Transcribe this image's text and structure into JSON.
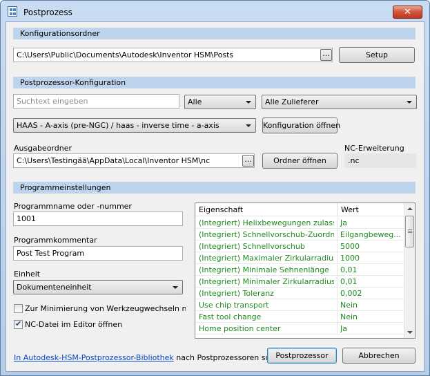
{
  "window": {
    "title": "Postprozess",
    "close_symbol": "✕",
    "icon": "app-icon"
  },
  "config_folder": {
    "section_title": "Konfigurationsordner",
    "path": "C:\\Users\\Public\\Documents\\Autodesk\\Inventor HSM\\Posts",
    "browse_label": "...",
    "setup_label": "Setup"
  },
  "post_config": {
    "section_title": "Postprozessor-Konfiguration",
    "search_placeholder": "Suchtext eingeben",
    "filter_value": "Alle",
    "vendor_value": "Alle Zulieferer",
    "config_value": "HAAS - A-axis (pre-NGC) / haas - inverse time - a-axis",
    "open_config_label": "Konfiguration öffnen"
  },
  "output": {
    "folder_label": "Ausgabeordner",
    "folder_path": "C:\\Users\\Testingää\\AppData\\Local\\Inventor HSM\\nc",
    "browse_label": "...",
    "open_folder_label": "Ordner öffnen",
    "nc_ext_label": "NC-Erweiterung",
    "nc_ext_value": ".nc"
  },
  "program": {
    "section_title": "Programmeinstellungen",
    "name_label": "Programmname oder -nummer",
    "name_value": "1001",
    "comment_label": "Programmkommentar",
    "comment_value": "Post Test Program",
    "unit_label": "Einheit",
    "unit_value": "Dokumenteneinheit",
    "minimize_label": "Zur Minimierung von Werkzeugwechseln neu ordn",
    "minimize_checked": false,
    "open_nc_label": "NC-Datei im Editor öffnen",
    "open_nc_checked": true
  },
  "properties": {
    "col_property": "Eigenschaft",
    "col_value": "Wert",
    "rows": [
      {
        "p": "(Integriert) Helixbewegungen zulassen",
        "v": "Ja"
      },
      {
        "p": "(Integriert) Schnellvorschub-Zuordnung",
        "v": "Eilgangbeweg..."
      },
      {
        "p": "(Integriert) Schnellvorschub",
        "v": "5000"
      },
      {
        "p": "(Integriert) Maximaler Zirkularradius",
        "v": "1000"
      },
      {
        "p": "(Integriert) Minimale Sehnenlänge",
        "v": "0,01"
      },
      {
        "p": "(Integriert) Minimaler Zirkularradius",
        "v": "0,01"
      },
      {
        "p": "(Integriert) Toleranz",
        "v": "0,002"
      },
      {
        "p": "Use chip transport",
        "v": "Nein"
      },
      {
        "p": "Fast tool change",
        "v": "Nein"
      },
      {
        "p": "Home position center",
        "v": "Ja"
      }
    ]
  },
  "footer": {
    "link_text": "In Autodesk-HSM-Postprozessor-Bibliothek",
    "link_suffix": " nach Postprozessoren suchen",
    "post_label": "Postprozessor",
    "cancel_label": "Abbrechen"
  }
}
